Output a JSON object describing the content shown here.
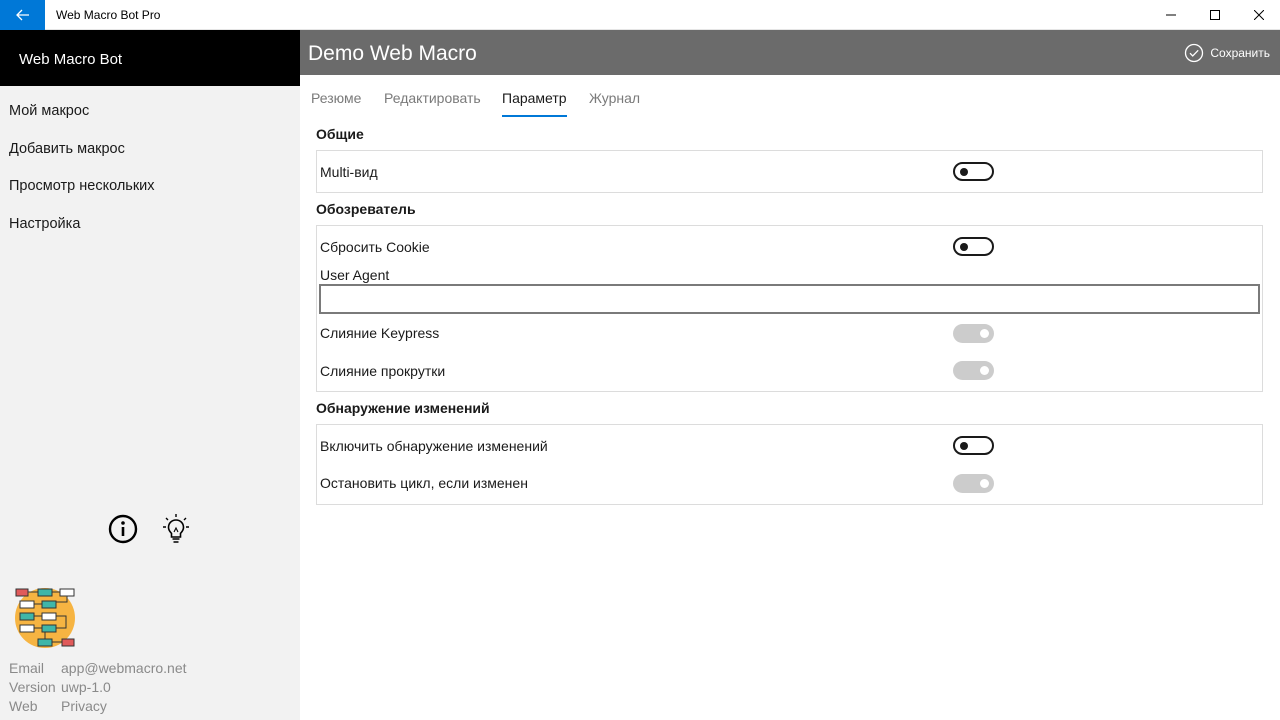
{
  "window": {
    "title": "Web Macro Bot Pro"
  },
  "sidebar": {
    "header": "Web Macro Bot",
    "items": [
      {
        "label": "Мой макрос"
      },
      {
        "label": "Добавить макрос"
      },
      {
        "label": "Просмотр нескольких"
      },
      {
        "label": "Настройка"
      }
    ],
    "meta": [
      {
        "key": "Email",
        "value": "app@webmacro.net"
      },
      {
        "key": "Version",
        "value": "uwp-1.0"
      },
      {
        "key": "Web",
        "value": "Privacy"
      }
    ]
  },
  "main": {
    "title": "Demo Web Macro",
    "save_label": "Сохранить",
    "tabs": [
      {
        "label": "Резюме"
      },
      {
        "label": "Редактировать"
      },
      {
        "label": "Параметр",
        "active": true
      },
      {
        "label": "Журнал"
      }
    ],
    "sections": [
      {
        "title": "Общие",
        "rows": [
          {
            "label": "Multi-вид",
            "toggle": "off"
          }
        ]
      },
      {
        "title": "Обозреватель",
        "rows": [
          {
            "label": "Сбросить Cookie",
            "toggle": "off"
          },
          {
            "label": "User Agent",
            "input_value": ""
          },
          {
            "label": "Слияние Keypress",
            "toggle": "disabled"
          },
          {
            "label": "Слияние прокрутки",
            "toggle": "disabled"
          }
        ]
      },
      {
        "title": "Обнаружение изменений",
        "rows": [
          {
            "label": "Включить обнаружение изменений",
            "toggle": "off"
          },
          {
            "label": "Остановить цикл, если изменен",
            "toggle": "disabled"
          }
        ]
      }
    ]
  },
  "colors": {
    "accent": "#0078d7",
    "header": "#6b6b6b",
    "sidebar": "#f2f2f2"
  }
}
